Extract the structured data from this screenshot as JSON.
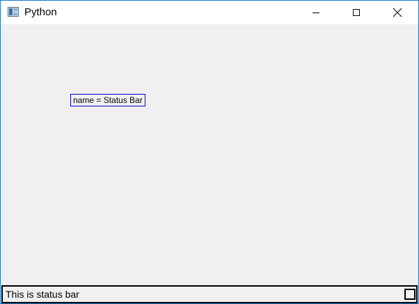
{
  "window": {
    "title": "Python",
    "icon": "python-app-icon",
    "controls": {
      "minimize_icon": "minimize-icon",
      "maximize_icon": "maximize-icon",
      "close_icon": "close-icon"
    }
  },
  "main": {
    "label_text": "name = Status Bar"
  },
  "statusbar": {
    "message": "This is status bar",
    "grip_icon": "size-grip-icon"
  },
  "colors": {
    "window_border": "#1979ca",
    "client_background": "#f0f0f0",
    "label_border": "#0000cc"
  }
}
